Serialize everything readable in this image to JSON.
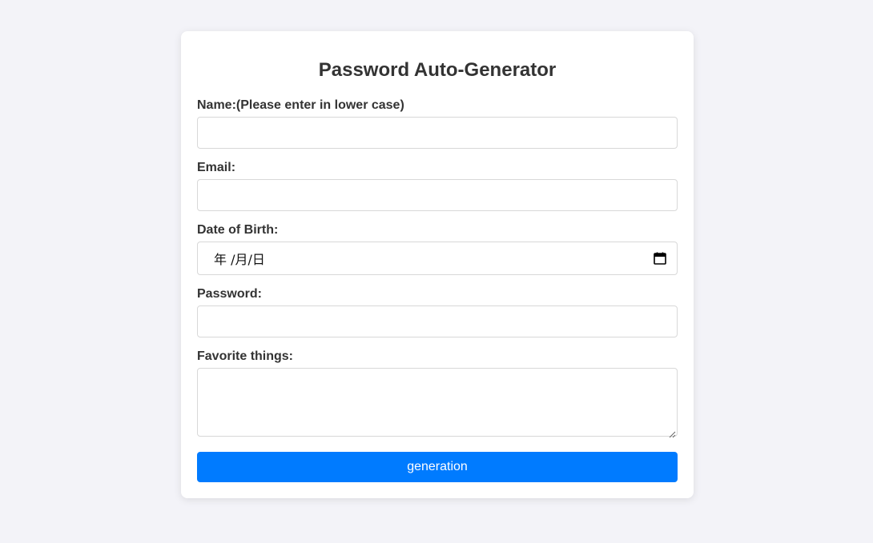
{
  "form": {
    "title": "Password Auto-Generator",
    "name_label": "Name:(Please enter in lower case)",
    "name_value": "",
    "email_label": "Email:",
    "email_value": "",
    "dob_label": "Date of Birth:",
    "dob_display": "年 /月/日",
    "password_label": "Password:",
    "password_value": "",
    "favorites_label": "Favorite things:",
    "favorites_value": "",
    "button_label": "generation"
  },
  "colors": {
    "background": "#f3f3f8",
    "card": "#ffffff",
    "text": "#333333",
    "button": "#007bff",
    "button_text": "#ffffff",
    "border": "#d8d8d8"
  },
  "icons": {
    "date_picker": "calendar-icon",
    "textarea_resize": "resize-grip-icon"
  }
}
